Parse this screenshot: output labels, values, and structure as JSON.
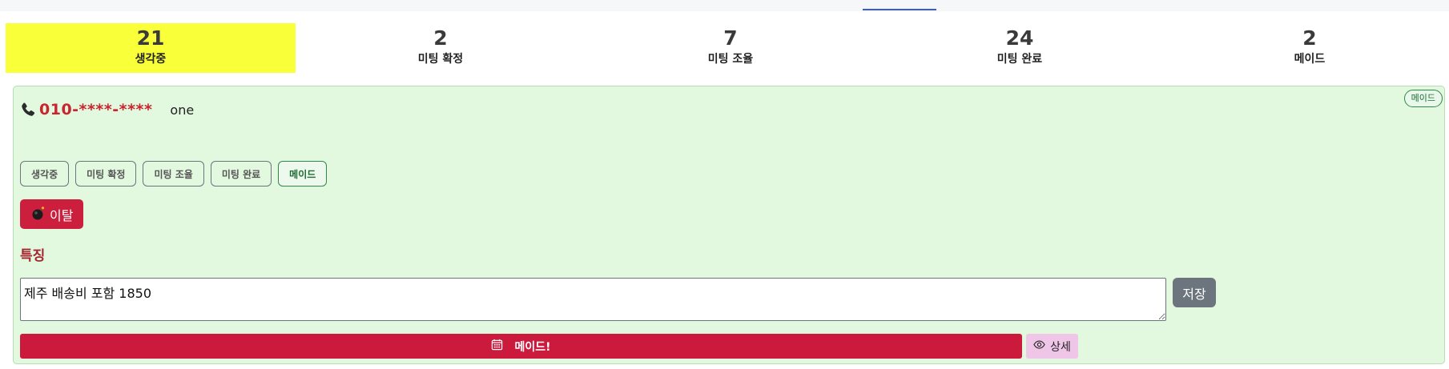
{
  "stats": [
    {
      "count": "21",
      "label": "생각중"
    },
    {
      "count": "2",
      "label": "미팅 확정"
    },
    {
      "count": "7",
      "label": "미팅 조율"
    },
    {
      "count": "24",
      "label": "미팅 완료"
    },
    {
      "count": "2",
      "label": "메이드"
    }
  ],
  "colors": {
    "active_stat": "#f9ff38",
    "card_bg": "#e2f8df",
    "danger": "#cc1f3e",
    "secondary": "#6c757d",
    "detail_bg": "#efc6e8"
  },
  "card": {
    "corner_badge": "메이드",
    "phone_icon": "phone-icon",
    "phone": "010-****-****",
    "name": "one",
    "status_buttons": [
      "생각중",
      "미팅 확정",
      "미팅 조율",
      "미팅 완료",
      "메이드"
    ],
    "selected_status": "메이드",
    "leave_icon": "bomb-icon",
    "leave_label": "이탈",
    "section_title": "특징",
    "memo_value": "제주 배송비 포함 1850",
    "save_label": "저장",
    "made_icon": "calendar-icon",
    "made_label": "메이드!",
    "detail_icon": "eye-icon",
    "detail_label": "상세"
  }
}
